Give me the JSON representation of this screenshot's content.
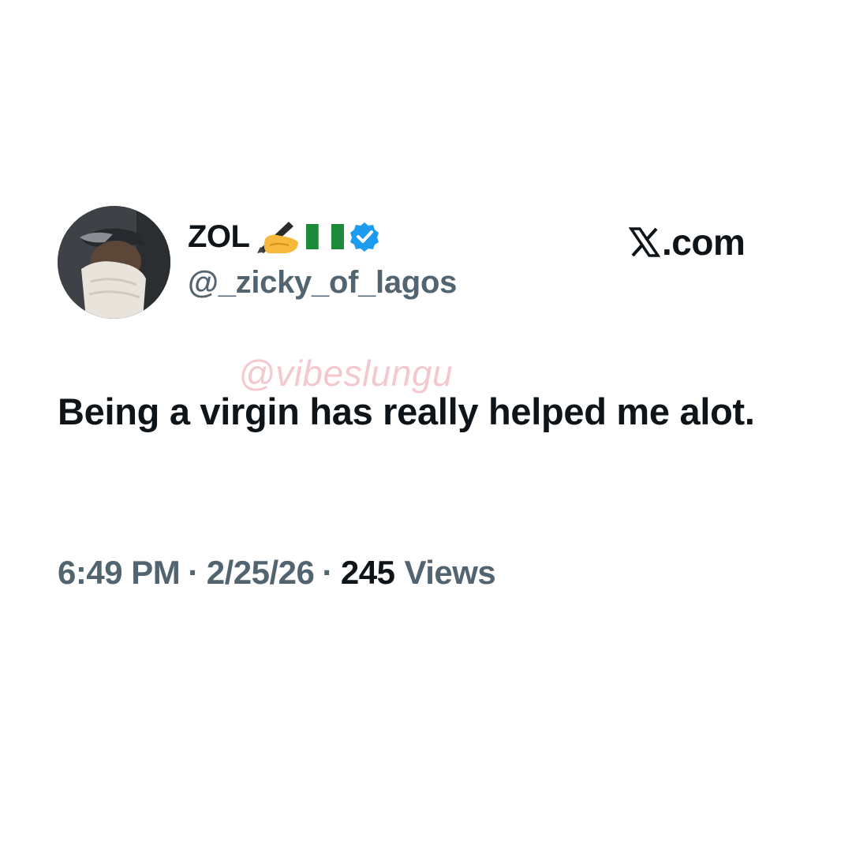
{
  "author": {
    "display_name": "ZOL",
    "emojis": [
      "writing-hand-emoji",
      "nigeria-flag-emoji"
    ],
    "verified": true,
    "handle": "@_zicky_of_lagos"
  },
  "brand": {
    "label": ".com",
    "icon": "x-logo-icon"
  },
  "watermark": {
    "text": "@vibeslungu"
  },
  "tweet": {
    "text": "Being a virgin has really helped me alot."
  },
  "meta": {
    "time": "6:49 PM",
    "separator": "·",
    "date": "2/25/26",
    "views_count": "245",
    "views_label": "Views"
  },
  "colors": {
    "text_primary": "#0f1419",
    "text_secondary": "#536471",
    "verified_blue": "#1d9bf0",
    "watermark_pink": "#e26e82"
  }
}
